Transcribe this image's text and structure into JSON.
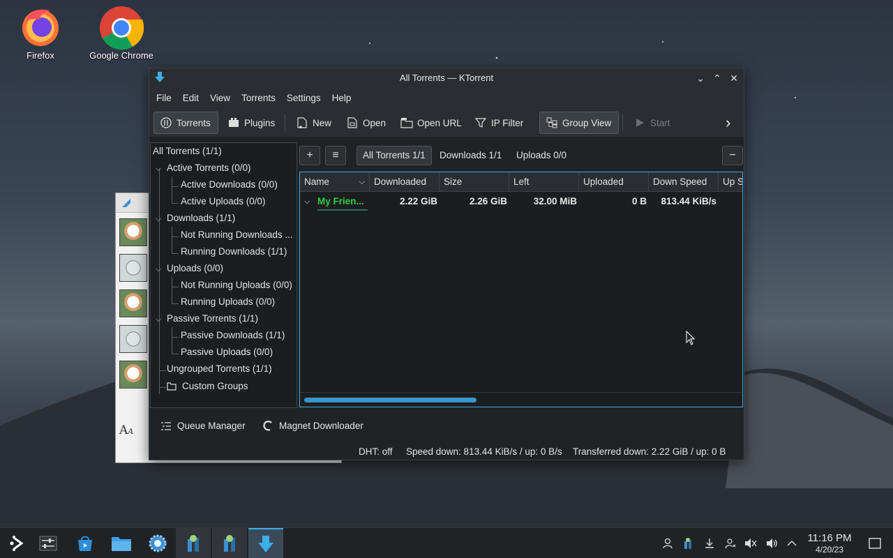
{
  "desktop": {
    "icons": [
      {
        "label": "Firefox"
      },
      {
        "label": "Google Chrome"
      }
    ]
  },
  "window": {
    "title": "All Torrents — KTorrent",
    "controls": {
      "minimize": "⌄",
      "maximize": "⌃",
      "close": "✕"
    }
  },
  "menu": [
    "File",
    "Edit",
    "View",
    "Torrents",
    "Settings",
    "Help"
  ],
  "toolbar": {
    "torrents": "Torrents",
    "plugins": "Plugins",
    "new": "New",
    "open": "Open",
    "open_url": "Open URL",
    "ip_filter": "IP Filter",
    "group_view": "Group View",
    "start": "Start",
    "more": "›"
  },
  "groups": [
    {
      "label": "All Torrents (1/1)"
    },
    {
      "label": "Active Torrents (0/0)"
    },
    {
      "label": "Active Downloads (0/0)"
    },
    {
      "label": "Active Uploads (0/0)"
    },
    {
      "label": "Downloads (1/1)"
    },
    {
      "label": "Not Running Downloads ..."
    },
    {
      "label": "Running Downloads (1/1)"
    },
    {
      "label": "Uploads (0/0)"
    },
    {
      "label": "Not Running Uploads (0/0)"
    },
    {
      "label": "Running Uploads (0/0)"
    },
    {
      "label": "Passive Torrents (1/1)"
    },
    {
      "label": "Passive Downloads (1/1)"
    },
    {
      "label": "Passive Uploads (0/0)"
    },
    {
      "label": "Ungrouped Torrents (1/1)"
    },
    {
      "label": "Custom Groups"
    }
  ],
  "view_tabs": {
    "add": "+",
    "menu": "≡",
    "all": "All Torrents 1/1",
    "downloads": "Downloads 1/1",
    "uploads": "Uploads 0/0",
    "close": "−"
  },
  "table": {
    "columns": [
      "Name",
      "Downloaded",
      "Size",
      "Left",
      "Uploaded",
      "Down Speed",
      "Up S"
    ],
    "rows": [
      {
        "name": "My Frien...",
        "downloaded": "2.22 GiB",
        "size": "2.26 GiB",
        "left": "32.00 MiB",
        "uploaded": "0 B",
        "down_speed": "813.44 KiB/s"
      }
    ]
  },
  "bottom_tabs": {
    "queue_manager": "Queue Manager",
    "magnet_downloader": "Magnet Downloader"
  },
  "status": {
    "dht": "DHT: off",
    "speed": "Speed down: 813.44 KiB/s / up: 0 B/s",
    "transferred": "Transferred down: 2.22 GiB / up: 0 B"
  },
  "taskbar": {
    "time": "11:16 PM",
    "date": "4/20/23"
  },
  "colors": {
    "accent": "#3daee9",
    "torrent_name": "#2ecc40"
  }
}
